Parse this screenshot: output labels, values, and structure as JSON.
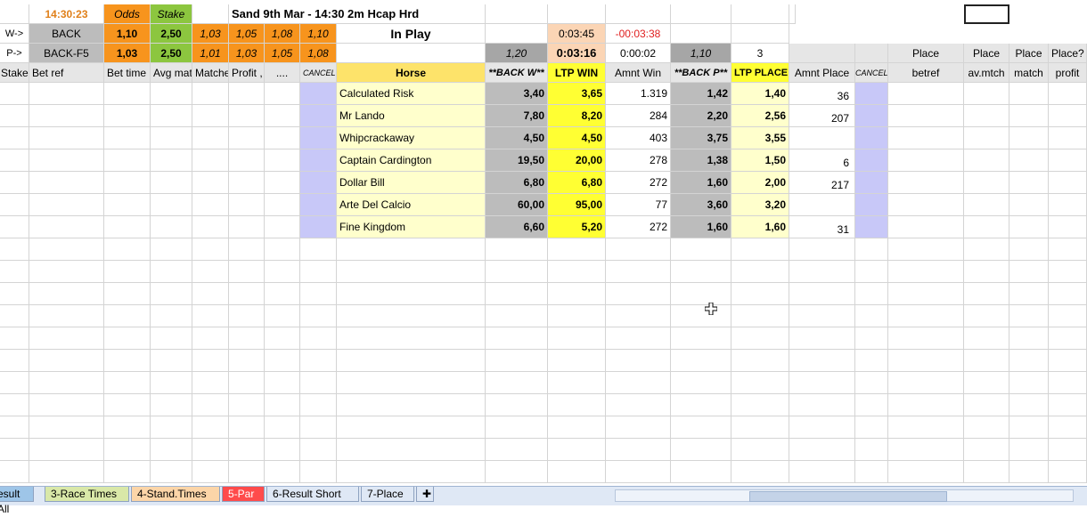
{
  "top": {
    "time": "14:30:23",
    "odds_label": "Odds",
    "stake_label": "Stake",
    "race_title": "Sand 9th Mar - 14:30 2m Hcap Hrd",
    "w_label": "W->",
    "w_bet": "BACK",
    "w_odds": "1,10",
    "w_stake": "2,50",
    "w_steps": [
      "1,03",
      "1,05",
      "1,08",
      "1,10"
    ],
    "in_play": "In Play",
    "t1": "0:03:45",
    "t2": "-00:03:38",
    "p_label": "P->",
    "p_bet": "BACK-F5",
    "p_odds": "1,03",
    "p_stake": "2,50",
    "p_steps": [
      "1,01",
      "1,03",
      "1,05",
      "1,08"
    ],
    "back_w_val": "1,20",
    "t3": "0:03:16",
    "t4": "0:00:02",
    "back_p_val": "1,10",
    "places": "3",
    "place_hdrs": [
      "Place",
      "Place",
      "Place",
      "Place?"
    ]
  },
  "headers": {
    "stake": "Stake",
    "bet_ref": "Bet ref",
    "bet_time": "Bet time",
    "avg_mat": "Avg mat",
    "matched": "Matche",
    "profit": "Profit ,",
    "dots": "....",
    "cancel": "CANCEL",
    "horse": "Horse",
    "back_w": "**BACK W**",
    "ltp_win": "LTP WIN",
    "amnt_win": "Amnt Win",
    "back_p": "**BACK P**",
    "ltp_place": "LTP PLACE",
    "amnt_place": "Amnt Place",
    "cancel2": "CANCEL",
    "betref": "betref",
    "av_mtch": "av.mtch",
    "match": "match",
    "profit2": "profit"
  },
  "horses": [
    {
      "name": "Calculated Risk",
      "back_w": "3,40",
      "ltp_win": "3,65",
      "amnt_win": "1.319",
      "back_p": "1,42",
      "ltp_place": "1,40",
      "amnt_place": "36"
    },
    {
      "name": "Mr Lando",
      "back_w": "7,80",
      "ltp_win": "8,20",
      "amnt_win": "284",
      "back_p": "2,20",
      "ltp_place": "2,56",
      "amnt_place": "207"
    },
    {
      "name": "Whipcrackaway",
      "back_w": "4,50",
      "ltp_win": "4,50",
      "amnt_win": "403",
      "back_p": "3,75",
      "ltp_place": "3,55",
      "amnt_place": ""
    },
    {
      "name": "Captain Cardington",
      "back_w": "19,50",
      "ltp_win": "20,00",
      "amnt_win": "278",
      "back_p": "1,38",
      "ltp_place": "1,50",
      "amnt_place": "6"
    },
    {
      "name": "Dollar Bill",
      "back_w": "6,80",
      "ltp_win": "6,80",
      "amnt_win": "272",
      "back_p": "1,60",
      "ltp_place": "2,00",
      "amnt_place": "217"
    },
    {
      "name": "Arte Del Calcio",
      "back_w": "60,00",
      "ltp_win": "95,00",
      "amnt_win": "77",
      "back_p": "3,60",
      "ltp_place": "3,20",
      "amnt_place": ""
    },
    {
      "name": "Fine Kingdom",
      "back_w": "6,60",
      "ltp_win": "5,20",
      "amnt_win": "272",
      "back_p": "1,60",
      "ltp_place": "1,60",
      "amnt_place": "31"
    }
  ],
  "tabs": [
    {
      "label": "esult All",
      "color": "#9ec5e8"
    },
    {
      "label": "3-Race Times",
      "color": "#d9e8a8"
    },
    {
      "label": "4-Stand.Times",
      "color": "#fcd5a8"
    },
    {
      "label": "5-Par",
      "color": "#ff4b4b"
    },
    {
      "label": "6-Result Short",
      "color": "#dfe8f5"
    },
    {
      "label": "7-Place",
      "color": "#dfe8f5"
    }
  ],
  "colors": {
    "orange": "#f7941d",
    "green": "#8cc63f",
    "yellow": "#ffff33",
    "lavender": "#c8c8f8"
  }
}
